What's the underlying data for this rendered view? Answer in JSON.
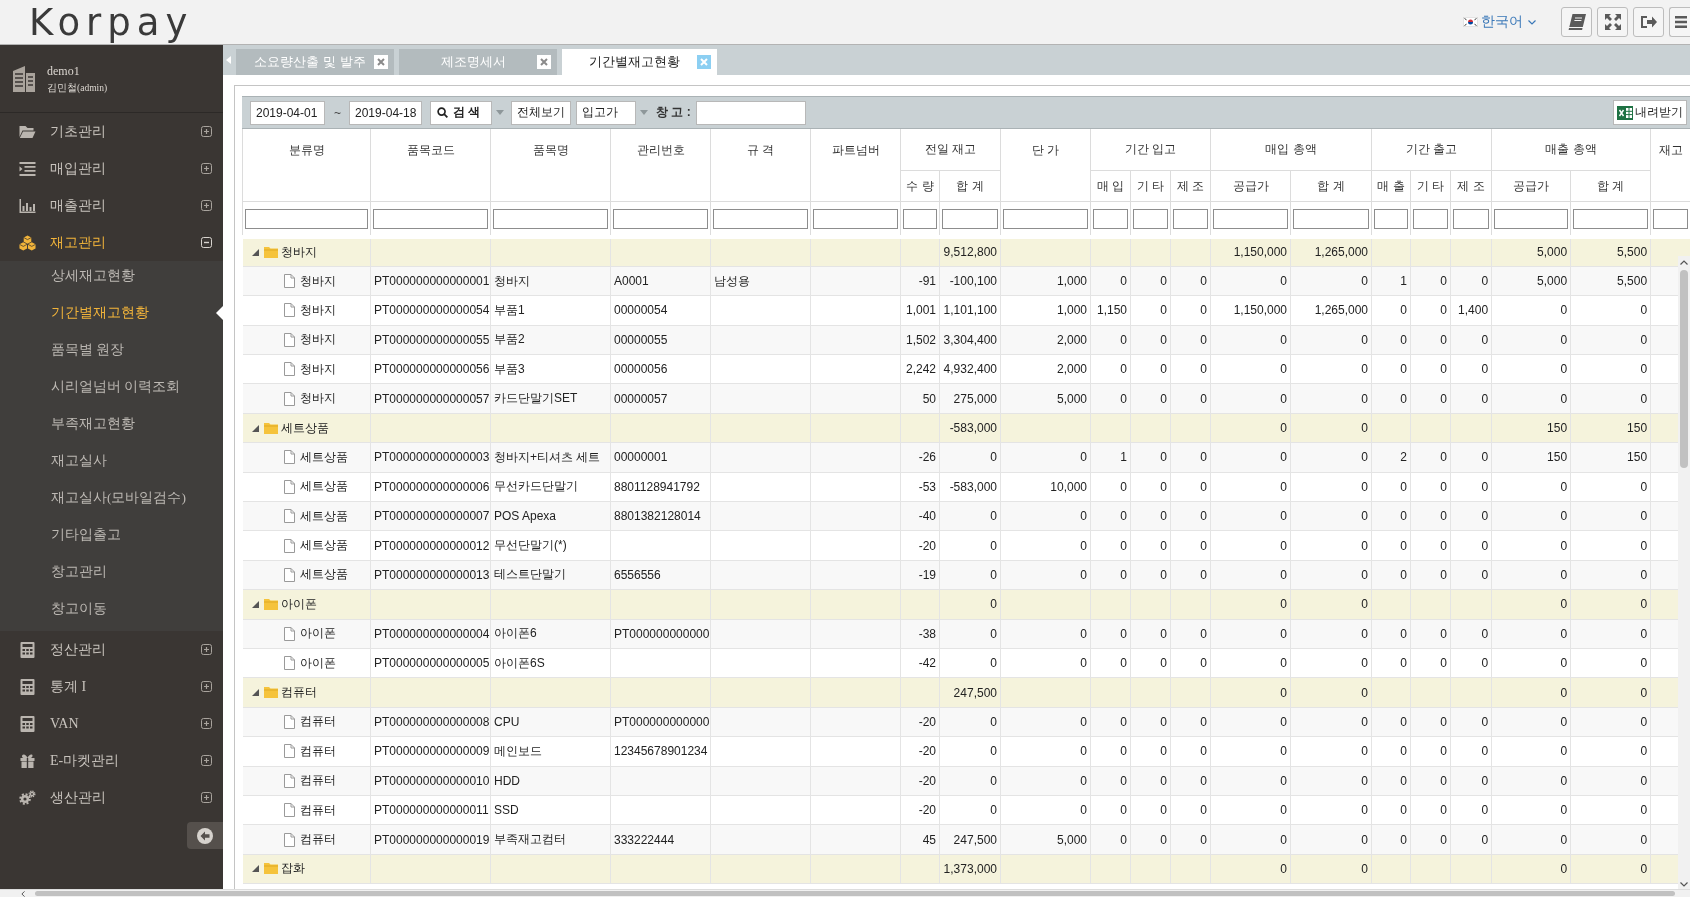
{
  "header": {
    "logo": "Korpay",
    "language": "한국어"
  },
  "sidebar": {
    "user": {
      "id": "demo1",
      "name": "김민철(admin)"
    },
    "items": [
      {
        "label": "기초관리",
        "expanded": false,
        "selected": false
      },
      {
        "label": "매입관리",
        "expanded": false,
        "selected": false
      },
      {
        "label": "매출관리",
        "expanded": false,
        "selected": false
      },
      {
        "label": "재고관리",
        "expanded": true,
        "selected": true,
        "children": [
          {
            "label": "상세재고현황",
            "selected": false
          },
          {
            "label": "기간별재고현황",
            "selected": true
          },
          {
            "label": "품목별 원장",
            "selected": false
          },
          {
            "label": "시리얼넘버 이력조회",
            "selected": false
          },
          {
            "label": "부족재고현황",
            "selected": false
          },
          {
            "label": "재고실사",
            "selected": false
          },
          {
            "label": "재고실사(모바일검수)",
            "selected": false
          },
          {
            "label": "기타입출고",
            "selected": false
          },
          {
            "label": "창고관리",
            "selected": false
          },
          {
            "label": "창고이동",
            "selected": false
          }
        ]
      },
      {
        "label": "정산관리",
        "expanded": false,
        "selected": false
      },
      {
        "label": "통계 I",
        "expanded": false,
        "selected": false
      },
      {
        "label": "VAN",
        "expanded": false,
        "selected": false
      },
      {
        "label": "E-마켓관리",
        "expanded": false,
        "selected": false
      },
      {
        "label": "생산관리",
        "expanded": false,
        "selected": false
      }
    ]
  },
  "tabs": [
    {
      "label": "소요량산출 및 발주",
      "selected": false
    },
    {
      "label": "제조명세서",
      "selected": false
    },
    {
      "label": "기간별재고현황",
      "selected": true
    }
  ],
  "toolbar": {
    "date_from": "2019-04-01",
    "range_separator": "~",
    "date_to": "2019-04-18",
    "search_button": "검 색",
    "view_all_button": "전체보기",
    "price_type": "입고가",
    "warehouse_label": "창 고 :",
    "download_button": "내려받기"
  },
  "table": {
    "columns": [
      {
        "label": "분류명"
      },
      {
        "label": "품목코드"
      },
      {
        "label": "품목명"
      },
      {
        "label": "관리번호"
      },
      {
        "label": "규 격"
      },
      {
        "label": "파트넘버"
      },
      {
        "label": "전일 재고",
        "children": [
          {
            "label": "수 량"
          },
          {
            "label": "합 계"
          }
        ]
      },
      {
        "label": "단 가"
      },
      {
        "label": "기간 입고",
        "children": [
          {
            "label": "매 입"
          },
          {
            "label": "기 타"
          },
          {
            "label": "제 조"
          }
        ]
      },
      {
        "label": "매입 총액",
        "children": [
          {
            "label": "공급가"
          },
          {
            "label": "합 계"
          }
        ]
      },
      {
        "label": "기간 출고",
        "children": [
          {
            "label": "매 출"
          },
          {
            "label": "기 타"
          },
          {
            "label": "제 조"
          }
        ]
      },
      {
        "label": "매출 총액",
        "children": [
          {
            "label": "공급가"
          },
          {
            "label": "합 계"
          }
        ]
      },
      {
        "label": "재고"
      }
    ],
    "groups": [
      {
        "category": "청바지",
        "expanded": true,
        "prev_total": "9,512,800",
        "purchase_supply": "1,150,000",
        "purchase_total": "1,265,000",
        "sales_supply": "5,000",
        "sales_total": "5,500",
        "children": [
          {
            "category": "청바지",
            "code": "PT000000000000001",
            "name": "청바지",
            "mgmt_no": "A0001",
            "spec": "남성용",
            "prev_qty": "-91",
            "prev_total": "-100,100",
            "unit_price": "1,000",
            "in_purchase": "0",
            "in_other": "0",
            "in_manufacture": "0",
            "purchase_supply": "0",
            "purchase_total": "0",
            "out_sales": "1",
            "out_other": "0",
            "out_manufacture": "0",
            "sales_supply": "5,000",
            "sales_total": "5,500"
          },
          {
            "category": "청바지",
            "code": "PT000000000000054",
            "name": "부품1",
            "mgmt_no": "00000054",
            "prev_qty": "1,001",
            "prev_total": "1,101,100",
            "unit_price": "1,000",
            "in_purchase": "1,150",
            "in_other": "0",
            "in_manufacture": "0",
            "purchase_supply": "1,150,000",
            "purchase_total": "1,265,000",
            "out_sales": "0",
            "out_other": "0",
            "out_manufacture": "1,400",
            "sales_supply": "0",
            "sales_total": "0"
          },
          {
            "category": "청바지",
            "code": "PT000000000000055",
            "name": "부품2",
            "mgmt_no": "00000055",
            "prev_qty": "1,502",
            "prev_total": "3,304,400",
            "unit_price": "2,000",
            "in_purchase": "0",
            "in_other": "0",
            "in_manufacture": "0",
            "purchase_supply": "0",
            "purchase_total": "0",
            "out_sales": "0",
            "out_other": "0",
            "out_manufacture": "0",
            "sales_supply": "0",
            "sales_total": "0"
          },
          {
            "category": "청바지",
            "code": "PT000000000000056",
            "name": "부품3",
            "mgmt_no": "00000056",
            "prev_qty": "2,242",
            "prev_total": "4,932,400",
            "unit_price": "2,000",
            "in_purchase": "0",
            "in_other": "0",
            "in_manufacture": "0",
            "purchase_supply": "0",
            "purchase_total": "0",
            "out_sales": "0",
            "out_other": "0",
            "out_manufacture": "0",
            "sales_supply": "0",
            "sales_total": "0"
          },
          {
            "category": "청바지",
            "code": "PT000000000000057",
            "name": "카드단말기SET",
            "mgmt_no": "00000057",
            "prev_qty": "50",
            "prev_total": "275,000",
            "unit_price": "5,000",
            "in_purchase": "0",
            "in_other": "0",
            "in_manufacture": "0",
            "purchase_supply": "0",
            "purchase_total": "0",
            "out_sales": "0",
            "out_other": "0",
            "out_manufacture": "0",
            "sales_supply": "0",
            "sales_total": "0"
          }
        ]
      },
      {
        "category": "세트상품",
        "expanded": true,
        "prev_total": "-583,000",
        "purchase_supply": "0",
        "purchase_total": "0",
        "sales_supply": "150",
        "sales_total": "150",
        "children": [
          {
            "category": "세트상품",
            "code": "PT000000000000003",
            "name": "청바지+티셔츠 세트",
            "mgmt_no": "00000001",
            "prev_qty": "-26",
            "prev_total": "0",
            "unit_price": "0",
            "in_purchase": "1",
            "in_other": "0",
            "in_manufacture": "0",
            "purchase_supply": "0",
            "purchase_total": "0",
            "out_sales": "2",
            "out_other": "0",
            "out_manufacture": "0",
            "sales_supply": "150",
            "sales_total": "150"
          },
          {
            "category": "세트상품",
            "code": "PT000000000000006",
            "name": "무선카드단말기",
            "mgmt_no": "8801128941792",
            "prev_qty": "-53",
            "prev_total": "-583,000",
            "unit_price": "10,000",
            "in_purchase": "0",
            "in_other": "0",
            "in_manufacture": "0",
            "purchase_supply": "0",
            "purchase_total": "0",
            "out_sales": "0",
            "out_other": "0",
            "out_manufacture": "0",
            "sales_supply": "0",
            "sales_total": "0"
          },
          {
            "category": "세트상품",
            "code": "PT000000000000007",
            "name": "POS Apexa",
            "mgmt_no": "8801382128014",
            "prev_qty": "-40",
            "prev_total": "0",
            "unit_price": "0",
            "in_purchase": "0",
            "in_other": "0",
            "in_manufacture": "0",
            "purchase_supply": "0",
            "purchase_total": "0",
            "out_sales": "0",
            "out_other": "0",
            "out_manufacture": "0",
            "sales_supply": "0",
            "sales_total": "0"
          },
          {
            "category": "세트상품",
            "code": "PT000000000000012",
            "name": "무선단말기(*)",
            "prev_qty": "-20",
            "prev_total": "0",
            "unit_price": "0",
            "in_purchase": "0",
            "in_other": "0",
            "in_manufacture": "0",
            "purchase_supply": "0",
            "purchase_total": "0",
            "out_sales": "0",
            "out_other": "0",
            "out_manufacture": "0",
            "sales_supply": "0",
            "sales_total": "0"
          },
          {
            "category": "세트상품",
            "code": "PT000000000000013",
            "name": "테스트단말기",
            "mgmt_no": "6556556",
            "prev_qty": "-19",
            "prev_total": "0",
            "unit_price": "0",
            "in_purchase": "0",
            "in_other": "0",
            "in_manufacture": "0",
            "purchase_supply": "0",
            "purchase_total": "0",
            "out_sales": "0",
            "out_other": "0",
            "out_manufacture": "0",
            "sales_supply": "0",
            "sales_total": "0"
          }
        ]
      },
      {
        "category": "아이폰",
        "expanded": true,
        "prev_total": "0",
        "purchase_supply": "0",
        "purchase_total": "0",
        "sales_supply": "0",
        "sales_total": "0",
        "children": [
          {
            "category": "아이폰",
            "code": "PT000000000000004",
            "name": "아이폰6",
            "mgmt_no": "PT000000000000",
            "prev_qty": "-38",
            "prev_total": "0",
            "unit_price": "0",
            "in_purchase": "0",
            "in_other": "0",
            "in_manufacture": "0",
            "purchase_supply": "0",
            "purchase_total": "0",
            "out_sales": "0",
            "out_other": "0",
            "out_manufacture": "0",
            "sales_supply": "0",
            "sales_total": "0"
          },
          {
            "category": "아이폰",
            "code": "PT000000000000005",
            "name": "아이폰6S",
            "prev_qty": "-42",
            "prev_total": "0",
            "unit_price": "0",
            "in_purchase": "0",
            "in_other": "0",
            "in_manufacture": "0",
            "purchase_supply": "0",
            "purchase_total": "0",
            "out_sales": "0",
            "out_other": "0",
            "out_manufacture": "0",
            "sales_supply": "0",
            "sales_total": "0"
          }
        ]
      },
      {
        "category": "컴퓨터",
        "expanded": true,
        "prev_total": "247,500",
        "purchase_supply": "0",
        "purchase_total": "0",
        "sales_supply": "0",
        "sales_total": "0",
        "children": [
          {
            "category": "컴퓨터",
            "code": "PT000000000000008",
            "name": "CPU",
            "mgmt_no": "PT000000000000",
            "prev_qty": "-20",
            "prev_total": "0",
            "unit_price": "0",
            "in_purchase": "0",
            "in_other": "0",
            "in_manufacture": "0",
            "purchase_supply": "0",
            "purchase_total": "0",
            "out_sales": "0",
            "out_other": "0",
            "out_manufacture": "0",
            "sales_supply": "0",
            "sales_total": "0"
          },
          {
            "category": "컴퓨터",
            "code": "PT000000000000009",
            "name": "메인보드",
            "mgmt_no": "12345678901234",
            "prev_qty": "-20",
            "prev_total": "0",
            "unit_price": "0",
            "in_purchase": "0",
            "in_other": "0",
            "in_manufacture": "0",
            "purchase_supply": "0",
            "purchase_total": "0",
            "out_sales": "0",
            "out_other": "0",
            "out_manufacture": "0",
            "sales_supply": "0",
            "sales_total": "0"
          },
          {
            "category": "컴퓨터",
            "code": "PT000000000000010",
            "name": "HDD",
            "prev_qty": "-20",
            "prev_total": "0",
            "unit_price": "0",
            "in_purchase": "0",
            "in_other": "0",
            "in_manufacture": "0",
            "purchase_supply": "0",
            "purchase_total": "0",
            "out_sales": "0",
            "out_other": "0",
            "out_manufacture": "0",
            "sales_supply": "0",
            "sales_total": "0"
          },
          {
            "category": "컴퓨터",
            "code": "PT000000000000011",
            "name": "SSD",
            "prev_qty": "-20",
            "prev_total": "0",
            "unit_price": "0",
            "in_purchase": "0",
            "in_other": "0",
            "in_manufacture": "0",
            "purchase_supply": "0",
            "purchase_total": "0",
            "out_sales": "0",
            "out_other": "0",
            "out_manufacture": "0",
            "sales_supply": "0",
            "sales_total": "0"
          },
          {
            "category": "컴퓨터",
            "code": "PT000000000000019",
            "name": "부족재고컴터",
            "mgmt_no": "333222444",
            "prev_qty": "45",
            "prev_total": "247,500",
            "unit_price": "5,000",
            "in_purchase": "0",
            "in_other": "0",
            "in_manufacture": "0",
            "purchase_supply": "0",
            "purchase_total": "0",
            "out_sales": "0",
            "out_other": "0",
            "out_manufacture": "0",
            "sales_supply": "0",
            "sales_total": "0"
          }
        ]
      },
      {
        "category": "잡화",
        "expanded": true,
        "prev_total": "1,373,000",
        "purchase_supply": "0",
        "purchase_total": "0",
        "sales_supply": "0",
        "sales_total": "0"
      }
    ]
  }
}
